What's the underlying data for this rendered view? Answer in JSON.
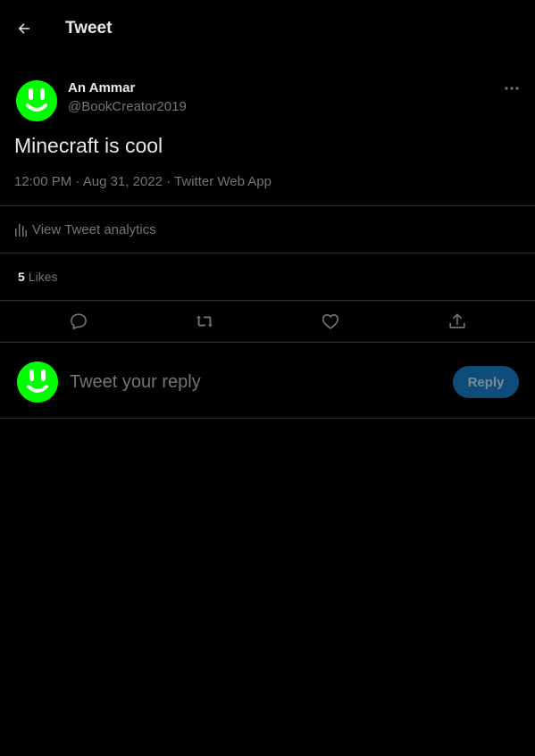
{
  "header": {
    "title": "Tweet",
    "back_icon": "arrow-left-icon"
  },
  "tweet": {
    "author_name": "An Ammar",
    "author_handle": "@BookCreator2019",
    "text": "Minecraft is cool",
    "time": "12:00 PM",
    "date": "Aug 31, 2022",
    "source": "Twitter Web App",
    "separator": " · ",
    "avatar_color": "#00ff00"
  },
  "analytics": {
    "label": "View Tweet analytics",
    "icon": "bar-chart-icon"
  },
  "stats": {
    "likes_count": "5",
    "likes_label": "Likes"
  },
  "actions": [
    "reply-icon",
    "retweet-icon",
    "like-icon",
    "share-icon"
  ],
  "reply": {
    "placeholder": "Tweet your reply",
    "button_label": "Reply",
    "button_color": "#0e4d7a"
  },
  "colors": {
    "background": "#000000",
    "text": "#e7e9ea",
    "secondary": "#71767b",
    "divider": "#2f3336"
  }
}
